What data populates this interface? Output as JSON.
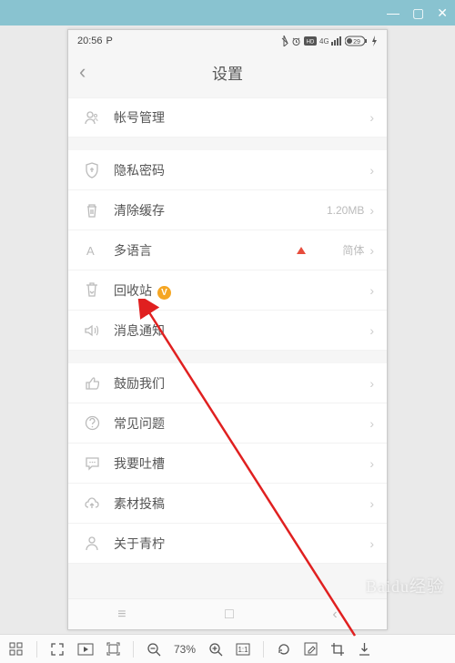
{
  "window": {
    "min": "—",
    "max": "▢",
    "close": "✕"
  },
  "status": {
    "time": "20:56",
    "p": "P",
    "battery": "29"
  },
  "header": {
    "title": "设置"
  },
  "rows": {
    "account": "帐号管理",
    "privacy": "隐私密码",
    "cache": "清除缓存",
    "cache_value": "1.20MB",
    "lang": "多语言",
    "lang_value": "简体",
    "recycle": "回收站",
    "notify": "消息通知",
    "encourage": "鼓励我们",
    "faq": "常见问题",
    "feedback": "我要吐槽",
    "submit": "素材投稿",
    "about": "关于青柠"
  },
  "toolbar": {
    "zoom": "73%"
  },
  "watermark": "Baidu经验"
}
